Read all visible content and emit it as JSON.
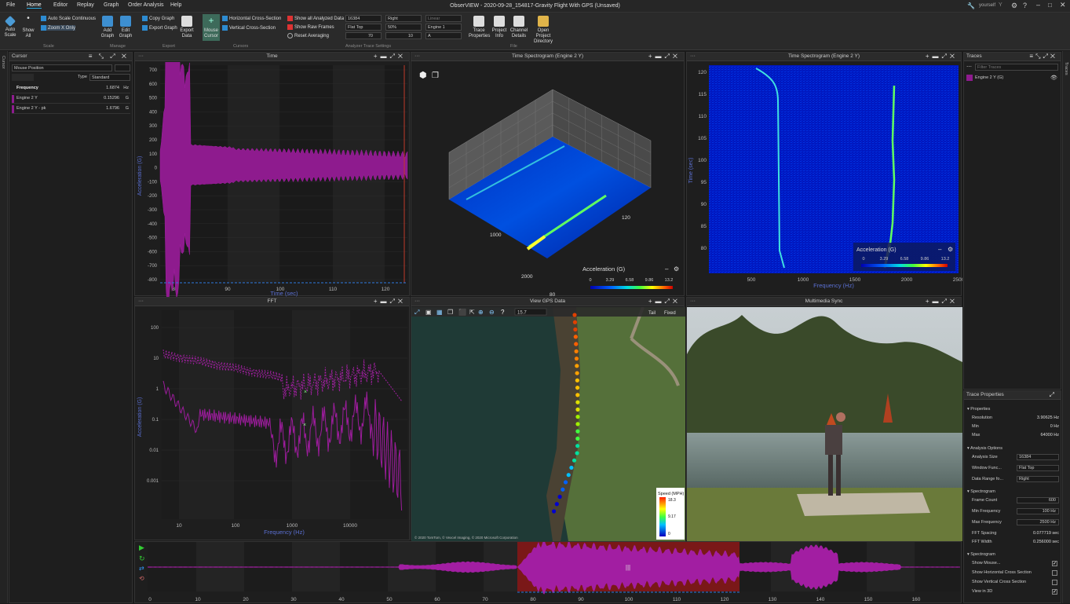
{
  "window": {
    "title": "ObserVIEW - 2020-09-28_154817-Gravity Flight With GPS (Unsaved)",
    "user": "yourself"
  },
  "menu": [
    "File",
    "Home",
    "Editor",
    "Replay",
    "Graph",
    "Order Analysis",
    "Help"
  ],
  "ribbon": {
    "auto_scale": "Auto Scale",
    "show_all": "Show All",
    "auto_scale_continuous": "Auto Scale Continuous",
    "zoom_x_only": "Zoom X Only",
    "scale_group": "Scale",
    "add_graph": "Add Graph",
    "edit_graph": "Edit Graph",
    "manage_group": "Manage",
    "copy_graph": "Copy Graph",
    "export_graph": "Export Graph",
    "export_data": "Export Data",
    "export_group": "Export",
    "mouse_cursor": "Mouse Cursor",
    "horizontal_cross_section": "Horizontal Cross-Section",
    "vertical_cross_section": "Vertical Cross-Section",
    "cursors_group": "Cursors",
    "show_all_analyzed": "Show all Analyzed Data",
    "show_raw_frames": "Show Raw Frames",
    "reset_averaging": "Reset Averaging",
    "analysis_group": "Analyzer Trace Settings",
    "sel_size": "16384",
    "sel_window": "Flat Top",
    "sel_range": "Right",
    "sel_overlap": "50%",
    "sel_linear": "Linear",
    "sel_engine": "Engine 1",
    "val_70": "70",
    "val_10": "10",
    "sel_axis": "A",
    "trace_properties": "Trace Properties",
    "project_info": "Project Info",
    "channel_details": "Channel Details",
    "open_project_directory": "Open Project Directory",
    "file_group": "File"
  },
  "cursor_panel": {
    "title": "Cursor",
    "mode": "Mouse Position",
    "type_label": "Type",
    "type_value": "Standard",
    "rows": [
      {
        "name": "Frequency",
        "value": "1.6874",
        "unit": "Hz"
      },
      {
        "name": "Engine 2 Y",
        "value": "0.15296",
        "unit": "G"
      },
      {
        "name": "Engine 2 Y - pk",
        "value": "1.6796",
        "unit": "G"
      }
    ]
  },
  "time_panel": {
    "title": "Time",
    "ylabel": "Acceleration (G)",
    "xlabel": "Time (sec)",
    "yticks": [
      "700",
      "600",
      "500",
      "400",
      "300",
      "200",
      "100",
      "0",
      "-100",
      "-200",
      "-300",
      "-400",
      "-500",
      "-600",
      "-700",
      "-800"
    ],
    "xticks": [
      "80",
      "90",
      "100",
      "110",
      "120"
    ]
  },
  "spectro3d_panel": {
    "title": "Time Spectrogram (Engine 2 Y)",
    "axis_1000": "1000",
    "axis_2000": "2000",
    "axis_120": "120",
    "axis_80": "80",
    "legend_title": "Acceleration (G)",
    "legend_ticks": [
      "0",
      "3.29",
      "6.58",
      "9.86",
      "13.2"
    ]
  },
  "spectro2d_panel": {
    "title": "Time Spectrogram (Engine 2 Y)",
    "ylabel": "Time (sec)",
    "xlabel": "Frequency (Hz)",
    "yticks": [
      "120",
      "115",
      "110",
      "105",
      "100",
      "95",
      "90",
      "85",
      "80"
    ],
    "xticks": [
      "500",
      "1000",
      "1500",
      "2000",
      "2500"
    ],
    "legend_title": "Acceleration (G)",
    "legend_ticks": [
      "0",
      "3.29",
      "6.58",
      "9.86",
      "13.2"
    ]
  },
  "fft_panel": {
    "title": "FFT",
    "ylabel": "Acceleration (G)",
    "xlabel": "Frequency (Hz)",
    "yticks": [
      "100",
      "10",
      "1",
      "0.1",
      "0.01",
      "0.001"
    ],
    "xticks": [
      "10",
      "100",
      "1000",
      "10000"
    ]
  },
  "gps_panel": {
    "title": "View GPS Data",
    "zoom": "15.7",
    "tail": "Tail",
    "fixed": "Fixed",
    "legend_title": "Speed (MPH)",
    "legend_ticks": [
      "18.3",
      "9.17",
      "0"
    ],
    "attribution": "© 2020 TomTom, © Vexcel Imaging, © 2020 Microsoft Corporation"
  },
  "media_panel": {
    "title": "Multimedia Sync"
  },
  "traces_panel": {
    "title": "Traces",
    "filter_placeholder": "Filter Traces",
    "trace_name": "Engine 2 Y (G)"
  },
  "trace_properties": {
    "title": "Trace Properties",
    "properties_label": "Properties",
    "resolution_label": "Resolution",
    "resolution": "3.90625 Hz",
    "min_label": "Min",
    "min": "0 Hz",
    "max_label": "Max",
    "max": "64000 Hz",
    "analysis_label": "Analysis Options",
    "analysis_size_label": "Analysis Size",
    "analysis_size": "16384",
    "window_label": "Window Func...",
    "window": "Flat Top",
    "range_label": "Data Range fo...",
    "range": "Right",
    "spectrogram_label": "Spectrogram",
    "frame_count_label": "Frame Count",
    "frame_count": "600",
    "min_freq_label": "Min Frequency",
    "min_freq": "100 Hz",
    "max_freq_label": "Max Frequency",
    "max_freq": "2500 Hz",
    "fft_spacing_label": "FFT Spacing",
    "fft_spacing": "0.077719 sec",
    "fft_width_label": "FFT Width",
    "fft_width": "0.256000 sec",
    "spectrogram2_label": "Spectrogram",
    "show_mouse_label": "Show Mouse...",
    "show_hcs_label": "Show Horizontal Cross Section",
    "show_vcs_label": "Show Vertical Cross Section",
    "view_3d_label": "View in 3D"
  },
  "timeline": {
    "xticks": [
      "0",
      "10",
      "20",
      "30",
      "40",
      "50",
      "60",
      "70",
      "80",
      "90",
      "100",
      "110",
      "120",
      "130",
      "140",
      "150",
      "160"
    ]
  },
  "side_tabs": {
    "left": "Cursor",
    "right": "Traces"
  }
}
